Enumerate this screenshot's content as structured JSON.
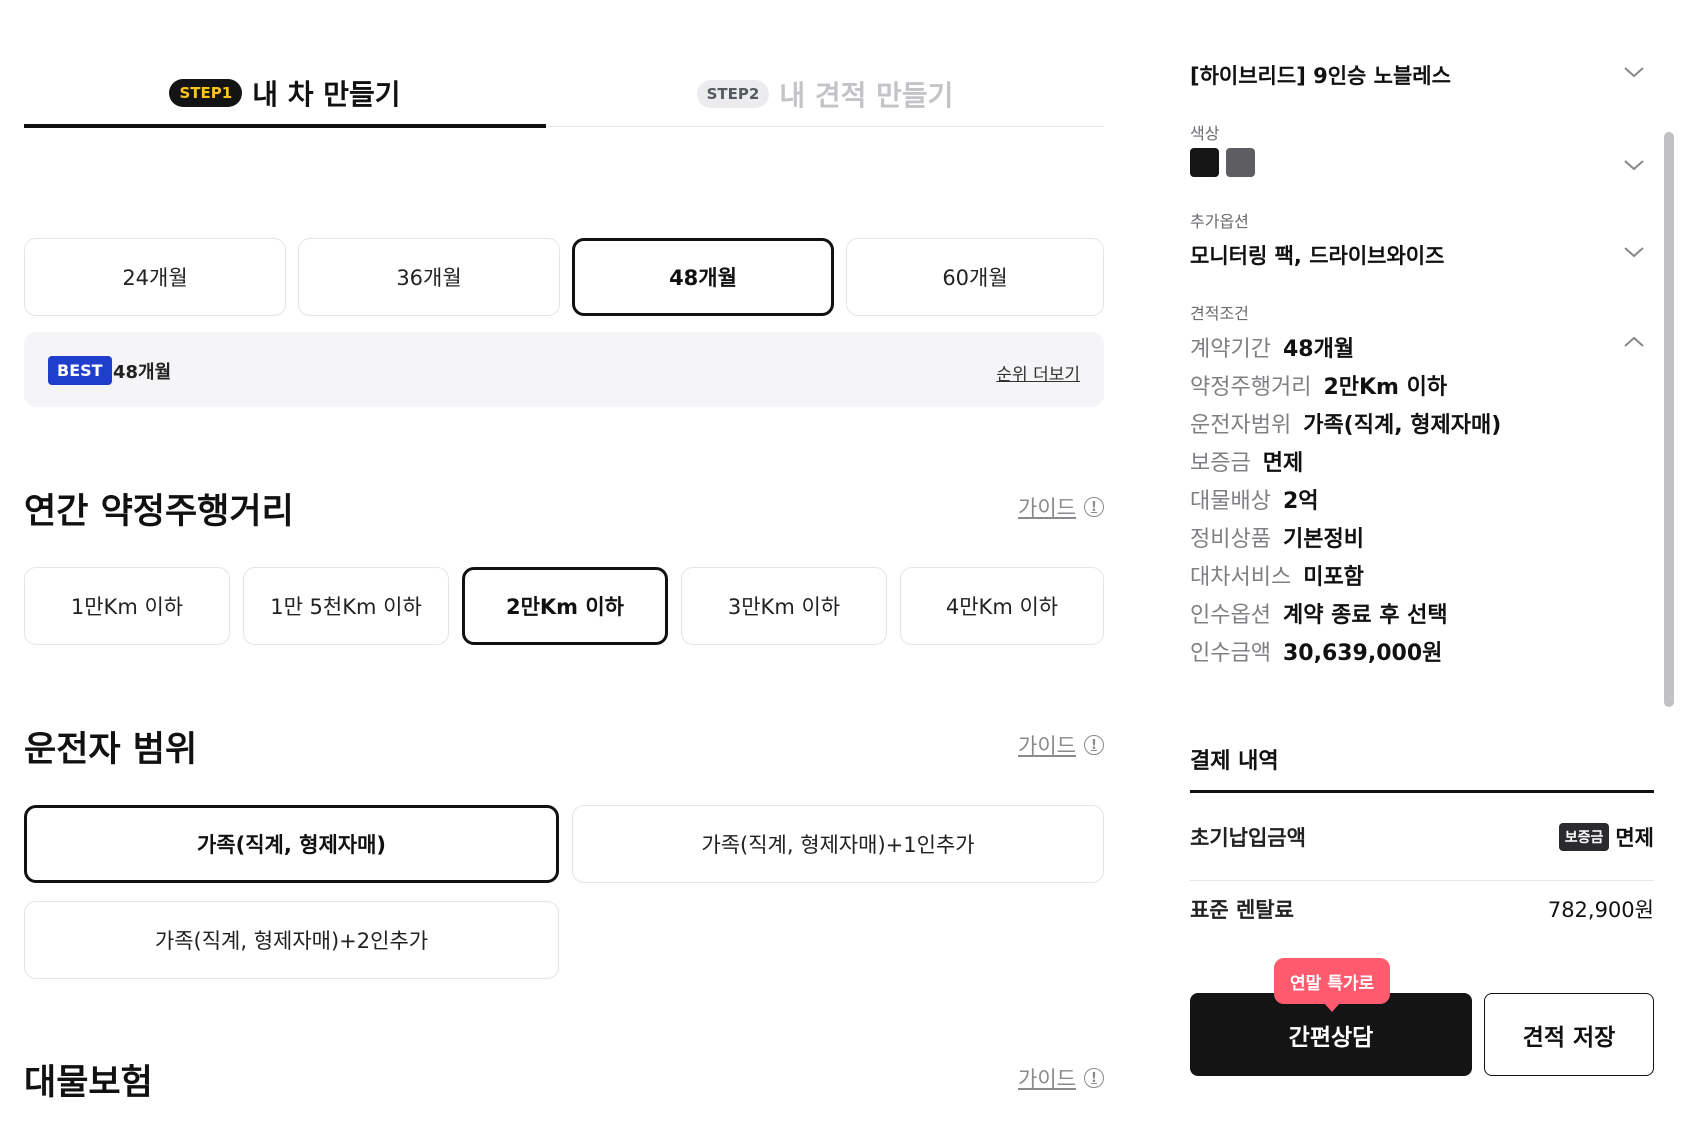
{
  "steps": [
    {
      "badge": "STEP1",
      "title": "내 차 만들기",
      "active": true
    },
    {
      "badge": "STEP2",
      "title": "내 견적 만들기",
      "active": false
    }
  ],
  "contract_period": {
    "options": [
      "24개월",
      "36개월",
      "48개월",
      "60개월"
    ],
    "selected": "48개월",
    "best_badge": "BEST",
    "best_value": "48개월",
    "more_link": "순위 더보기"
  },
  "mileage": {
    "title": "연간 약정주행거리",
    "guide": "가이드",
    "options": [
      "1만Km 이하",
      "1만 5천Km 이하",
      "2만Km 이하",
      "3만Km 이하",
      "4만Km 이하"
    ],
    "selected": "2만Km 이하"
  },
  "driver_range": {
    "title": "운전자 범위",
    "guide": "가이드",
    "options": [
      "가족(직계, 형제자매)",
      "가족(직계, 형제자매)+1인추가",
      "가족(직계, 형제자매)+2인추가"
    ],
    "selected": "가족(직계, 형제자매)"
  },
  "property_insurance": {
    "title": "대물보험",
    "guide": "가이드"
  },
  "summary": {
    "trim_value": "[하이브리드] 9인승 노블레스",
    "color_label": "색상",
    "colors": [
      "#151515",
      "#5e5e62"
    ],
    "option_label": "추가옵션",
    "option_value": "모니터링 팩, 드라이브와이즈",
    "cond_label": "견적조건",
    "conditions": [
      {
        "k": "계약기간",
        "v": "48개월"
      },
      {
        "k": "약정주행거리",
        "v": "2만Km 이하"
      },
      {
        "k": "운전자범위",
        "v": "가족(직계, 형제자매)"
      },
      {
        "k": "보증금",
        "v": "면제"
      },
      {
        "k": "대물배상",
        "v": "2억"
      },
      {
        "k": "정비상품",
        "v": "기본정비"
      },
      {
        "k": "대차서비스",
        "v": "미포함"
      },
      {
        "k": "인수옵션",
        "v": "계약 종료 후 선택"
      },
      {
        "k": "인수금액",
        "v": "30,639,000원"
      }
    ]
  },
  "payment": {
    "title": "결제 내역",
    "initial_label": "초기납입금액",
    "deposit_badge": "보증금",
    "initial_value": "면제",
    "rental_label": "표준 렌탈료",
    "rental_value": "782,900원",
    "promo": "연말 특가로",
    "consult_button": "간편상담",
    "save_button": "견적 저장"
  }
}
